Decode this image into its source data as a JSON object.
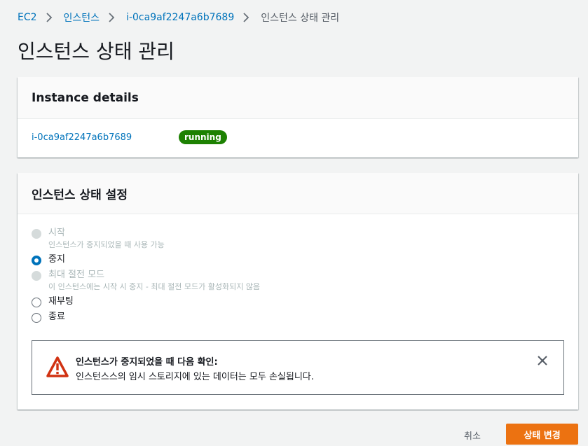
{
  "breadcrumb": {
    "items": [
      "EC2",
      "인스턴스",
      "i-0ca9af2247a6b7689"
    ],
    "current": "인스턴스 상태 관리"
  },
  "page_title": "인스턴스 상태 관리",
  "instance_details": {
    "title": "Instance details",
    "instance_id": "i-0ca9af2247a6b7689",
    "state": "running",
    "state_color": "#1d8102"
  },
  "state_settings": {
    "title": "인스턴스 상태 설정",
    "options": [
      {
        "label": "시작",
        "description": "인스턴스가 중지되었을 때 사용 가능",
        "disabled": true,
        "selected": false
      },
      {
        "label": "중지",
        "description": "",
        "disabled": false,
        "selected": true
      },
      {
        "label": "최대 절전 모드",
        "description": "이 인스턴스에는 시작 시 중지 - 최대 절전 모드가 활성화되지 않음",
        "disabled": true,
        "selected": false
      },
      {
        "label": "재부팅",
        "description": "",
        "disabled": false,
        "selected": false
      },
      {
        "label": "종료",
        "description": "",
        "disabled": false,
        "selected": false
      }
    ],
    "alert": {
      "icon": "warning-icon",
      "title": "인스턴스가 중지되었을 때 다음 확인:",
      "message": "인스턴스스의 임시 스토리지에 있는 데이터는 모두 손실됩니다."
    }
  },
  "footer": {
    "cancel_label": "취소",
    "submit_label": "상태 변경",
    "accent_color": "#ec7211"
  }
}
